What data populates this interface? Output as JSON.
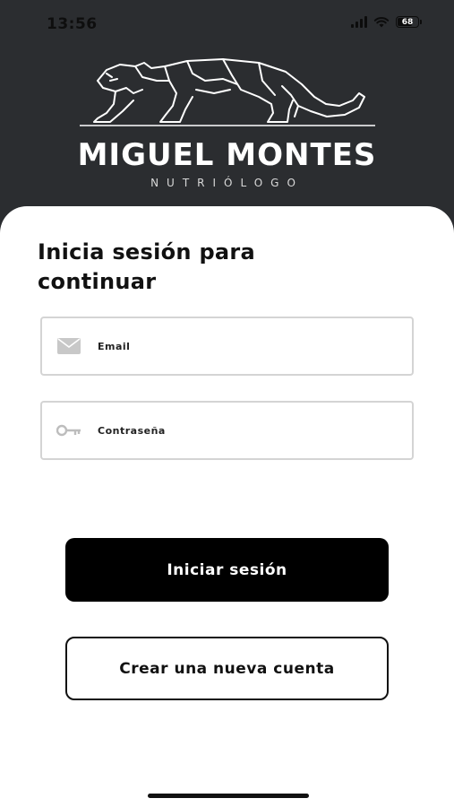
{
  "status_bar": {
    "time": "13:56",
    "battery": "68"
  },
  "brand": {
    "name": "MIGUEL MONTES",
    "tagline": "NUTRIÓLOGO"
  },
  "login": {
    "headline": "Inicia sesión para continuar",
    "email_placeholder": "Email",
    "password_placeholder": "Contraseña",
    "login_button": "Iniciar sesión",
    "create_account_button": "Crear una nueva cuenta"
  },
  "icons": {
    "email": "envelope-icon",
    "password": "key-icon",
    "logo": "panther-logo"
  },
  "colors": {
    "header_bg": "#2b2d30",
    "primary_button": "#000000",
    "card_bg": "#ffffff"
  }
}
